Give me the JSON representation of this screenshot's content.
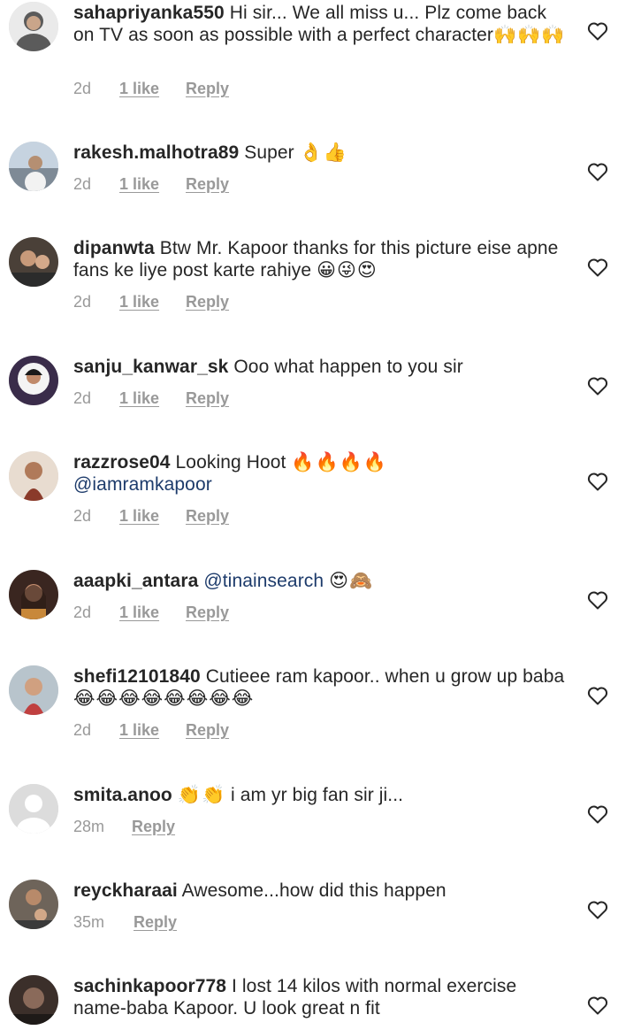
{
  "comments": [
    {
      "username": "sahapriyanka550",
      "text": "Hi sir... We all miss u... Plz come back on TV as soon as possible with a perfect character",
      "emoji": "🙌🙌🙌",
      "mention": "",
      "time": "2d",
      "likes": "1 like",
      "reply": "Reply",
      "avatar_color": "#5b5b5b",
      "like_icon": "heart-outline-icon"
    },
    {
      "username": "rakesh.malhotra89",
      "text": "Super",
      "emoji": "👌👍",
      "mention": "",
      "time": "2d",
      "likes": "1 like",
      "reply": "Reply",
      "avatar_color": "#9aa7b5",
      "like_icon": "heart-outline-icon"
    },
    {
      "username": "dipanwta",
      "text": "Btw Mr. Kapoor thanks for this picture eise apne fans ke liye post karte rahiye",
      "emoji": "😀😜😍",
      "mention": "",
      "time": "2d",
      "likes": "1 like",
      "reply": "Reply",
      "avatar_color": "#6b5a4a",
      "like_icon": "heart-outline-icon"
    },
    {
      "username": "sanju_kanwar_sk",
      "text": "Ooo what happen to you sir",
      "emoji": "",
      "mention": "",
      "time": "2d",
      "likes": "1 like",
      "reply": "Reply",
      "avatar_color": "#3a2c4a",
      "like_icon": "heart-outline-icon"
    },
    {
      "username": "razzrose04",
      "text": "Looking Hoot",
      "emoji": "🔥🔥🔥🔥",
      "mention": "@iamramkapoor",
      "time": "2d",
      "likes": "1 like",
      "reply": "Reply",
      "avatar_color": "#8a5b3a",
      "like_icon": "heart-outline-icon"
    },
    {
      "username": "aaapki_antara",
      "text": "",
      "emoji": "😍🙈",
      "mention": "@tinainsearch",
      "time": "2d",
      "likes": "1 like",
      "reply": "Reply",
      "avatar_color": "#4a2e24",
      "like_icon": "heart-outline-icon"
    },
    {
      "username": "shefi12101840",
      "text": "Cutieee ram kapoor.. when u grow up baba",
      "emoji": "😂😂😂😂😂😂😂😂",
      "mention": "",
      "time": "2d",
      "likes": "1 like",
      "reply": "Reply",
      "avatar_color": "#8c7a6a",
      "like_icon": "heart-outline-icon"
    },
    {
      "username": "smita.anoo",
      "text": "i am yr big fan sir ji...",
      "emoji": "👏👏",
      "mention": "",
      "time": "28m",
      "likes": "",
      "reply": "Reply",
      "avatar_color": "#dcdcdc",
      "like_icon": "heart-outline-icon"
    },
    {
      "username": "reyckharaai",
      "text": "Awesome...how did this happen",
      "emoji": "",
      "mention": "",
      "time": "35m",
      "likes": "",
      "reply": "Reply",
      "avatar_color": "#5e544c",
      "like_icon": "heart-outline-icon"
    },
    {
      "username": "sachinkapoor778",
      "text": "I lost 14 kilos with normal exercise name-baba Kapoor. U look great n fit",
      "emoji": "",
      "mention": "",
      "time": "",
      "likes": "",
      "reply": "",
      "avatar_color": "#3b2f2a",
      "like_icon": "heart-outline-icon"
    }
  ]
}
